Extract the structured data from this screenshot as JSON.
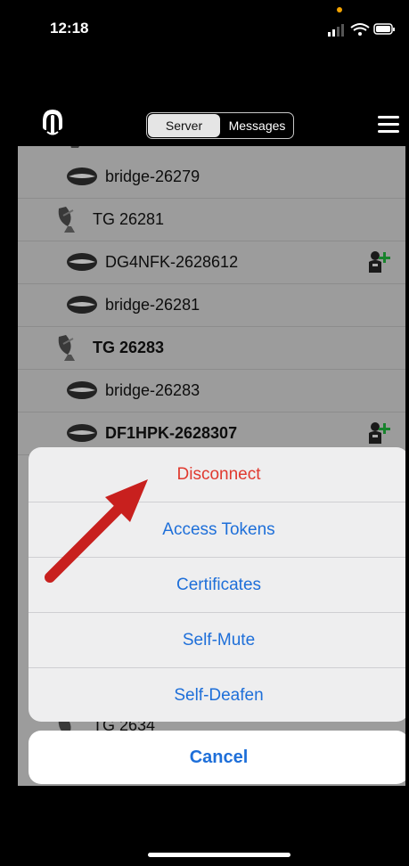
{
  "status": {
    "time": "12:18"
  },
  "nav": {
    "tabs": [
      {
        "label": "Server",
        "selected": true
      },
      {
        "label": "Messages",
        "selected": false
      }
    ]
  },
  "list": {
    "rows": [
      {
        "type": "user",
        "label": "bridge-26279",
        "bold": false,
        "icon": "lips-icon"
      },
      {
        "type": "channel",
        "label": "TG 26281",
        "bold": false,
        "icon": "satellite-dish-icon"
      },
      {
        "type": "user",
        "label": "DG4NFK-2628612",
        "bold": false,
        "icon": "lips-icon",
        "badge": "register-user-icon"
      },
      {
        "type": "user",
        "label": "bridge-26281",
        "bold": false,
        "icon": "lips-icon"
      },
      {
        "type": "channel",
        "label": "TG 26283",
        "bold": true,
        "icon": "satellite-dish-icon"
      },
      {
        "type": "user",
        "label": "bridge-26283",
        "bold": false,
        "icon": "lips-icon"
      },
      {
        "type": "user",
        "label": "DF1HPK-2628307",
        "bold": true,
        "icon": "lips-icon",
        "badge": "register-user-icon"
      }
    ],
    "partial_label": "TG 2634"
  },
  "action_sheet": {
    "items": [
      {
        "label": "Disconnect",
        "destructive": true
      },
      {
        "label": "Access Tokens",
        "destructive": false
      },
      {
        "label": "Certificates",
        "destructive": false
      },
      {
        "label": "Self-Mute",
        "destructive": false
      },
      {
        "label": "Self-Deafen",
        "destructive": false
      }
    ],
    "cancel_label": "Cancel"
  },
  "colors": {
    "accent": "#1e6fd9",
    "destructive": "#e0392f",
    "arrow": "#c8201e"
  }
}
